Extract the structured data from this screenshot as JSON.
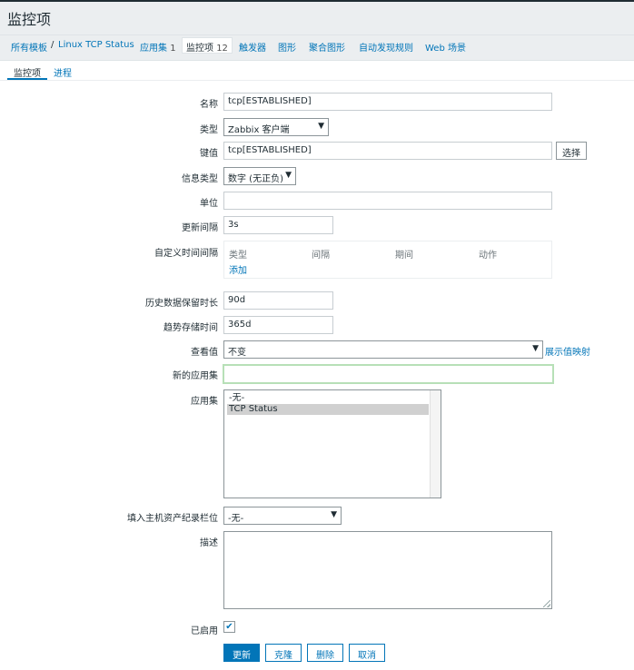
{
  "page_title": "监控项",
  "breadcrumb": {
    "all_templates": "所有模板",
    "separator": "/",
    "template": "Linux TCP Status",
    "applications": "应用集",
    "applications_count": "1",
    "items": "监控项",
    "items_count": "12",
    "triggers": "触发器",
    "graphs": "图形",
    "screens": "聚合图形",
    "discovery": "自动发现规则",
    "web": "Web 场景"
  },
  "tabs": {
    "item": "监控项",
    "process": "进程"
  },
  "form": {
    "name": {
      "label": "名称",
      "value": "tcp[ESTABLISHED]"
    },
    "type": {
      "label": "类型",
      "value": "Zabbix 客户端"
    },
    "key": {
      "label": "键值",
      "value": "tcp[ESTABLISHED]",
      "select_button": "选择"
    },
    "info_type": {
      "label": "信息类型",
      "value": "数字 (无正负)"
    },
    "units": {
      "label": "单位",
      "value": ""
    },
    "update_interval": {
      "label": "更新间隔",
      "value": "3s"
    },
    "custom_intervals": {
      "label": "自定义时间间隔",
      "columns": [
        "类型",
        "间隔",
        "期间",
        "动作"
      ],
      "add_link": "添加"
    },
    "history": {
      "label": "历史数据保留时长",
      "value": "90d"
    },
    "trends": {
      "label": "趋势存储时间",
      "value": "365d"
    },
    "show_value": {
      "label": "查看值",
      "value": "不变",
      "mapping_link": "展示值映射"
    },
    "new_application": {
      "label": "新的应用集",
      "value": ""
    },
    "applications": {
      "label": "应用集",
      "options": [
        "-无-",
        "TCP Status"
      ],
      "selected": "TCP Status"
    },
    "inventory": {
      "label": "填入主机资产纪录栏位",
      "value": "-无-"
    },
    "description": {
      "label": "描述",
      "value": ""
    },
    "enabled": {
      "label": "已启用",
      "checked": true,
      "check_mark": "✔"
    }
  },
  "buttons": {
    "update": "更新",
    "clone": "克隆",
    "delete": "删除",
    "cancel": "取消"
  },
  "colors": {
    "accent": "#0275b8",
    "focus_border": "#b7e0b7"
  },
  "icons": {
    "dropdown": "caret-down-icon",
    "check": "checkmark-icon",
    "resize": "resize-grip-icon"
  }
}
